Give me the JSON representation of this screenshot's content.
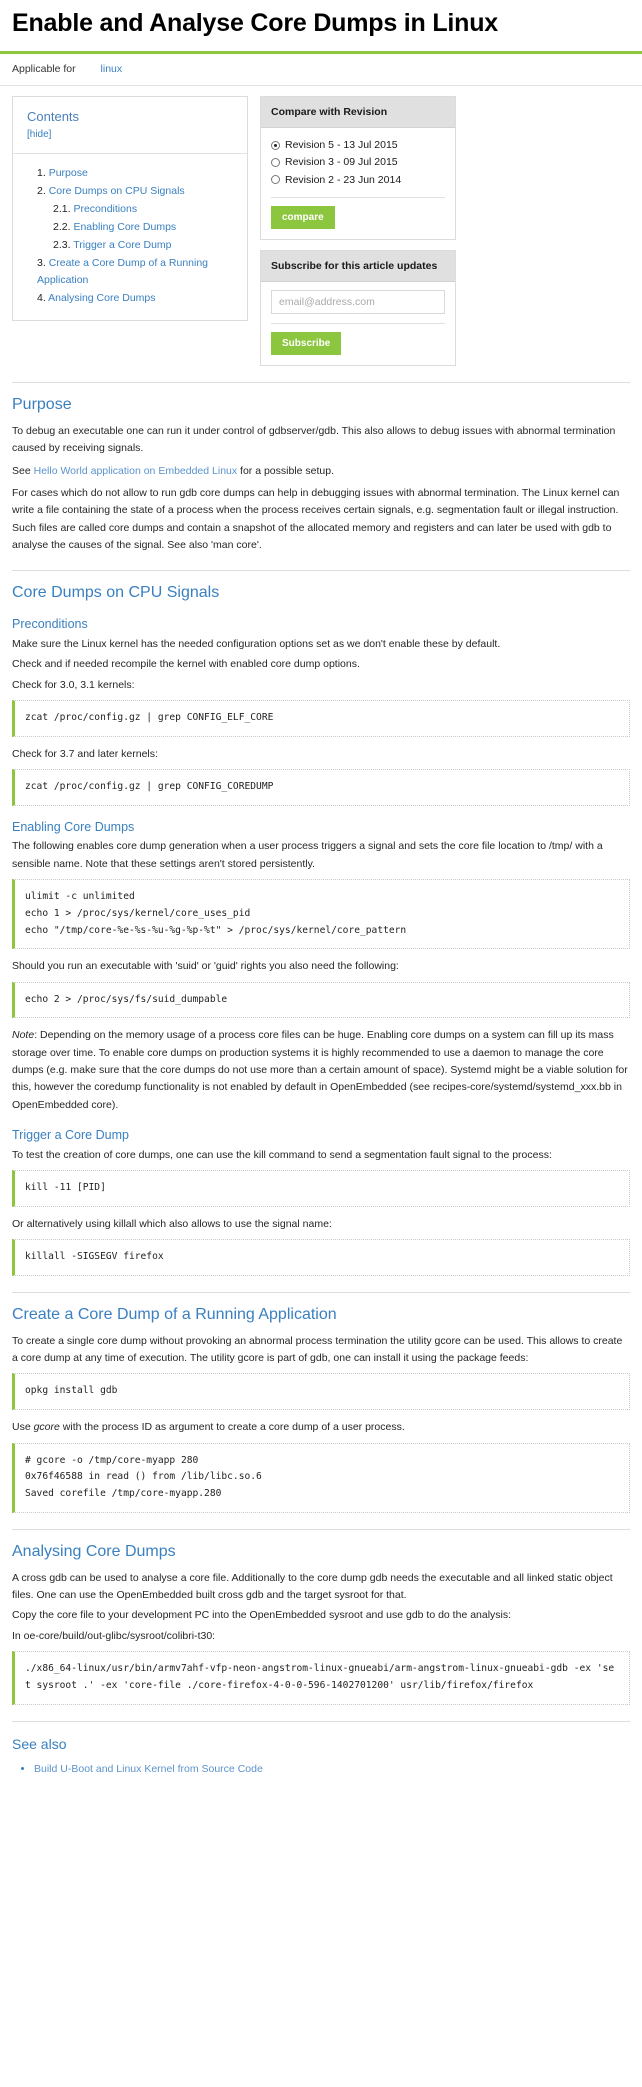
{
  "header": {
    "title": "Enable and Analyse Core Dumps in Linux",
    "applicable_label": "Applicable for",
    "applicable_tag": "linux",
    "accent_green": "#8cc63e",
    "link_blue": "#3a80c1"
  },
  "toc": {
    "title": "Contents",
    "hide_label": "[hide]",
    "items": [
      {
        "label": "Purpose",
        "children": []
      },
      {
        "label": "Core Dumps on CPU Signals",
        "children": [
          {
            "label": "Preconditions"
          },
          {
            "label": "Enabling Core Dumps"
          },
          {
            "label": "Trigger a Core Dump"
          }
        ]
      },
      {
        "label": "Create a Core Dump of a Running Application",
        "children": []
      },
      {
        "label": "Analysing Core Dumps",
        "children": []
      }
    ]
  },
  "compare_widget": {
    "title": "Compare with Revision",
    "revisions": [
      {
        "label": "Revision 5 - 13 Jul 2015",
        "checked": true
      },
      {
        "label": "Revision 3 - 09 Jul 2015",
        "checked": false
      },
      {
        "label": "Revision 2 - 23 Jun 2014",
        "checked": false
      }
    ],
    "button_label": "compare"
  },
  "subscribe_widget": {
    "title": "Subscribe for this article updates",
    "email_placeholder": "email@address.com",
    "email_value": "",
    "button_label": "Subscribe"
  },
  "sections": {
    "purpose": {
      "heading": "Purpose",
      "p1a": "To debug an executable one can run it under control of gdbserver/gdb. This also allows to debug issues with abnormal termination caused by receiving signals.",
      "p2_pre": "See ",
      "p2_link": "Hello World application on Embedded Linux",
      "p2_post": " for a possible setup.",
      "p3": "For cases which do not allow to run gdb core dumps can help in debugging issues with abnormal termination. The Linux kernel can write a file containing the state of a process when the process receives certain signals, e.g. segmentation fault or illegal instruction. Such files are called core dumps and contain a snapshot of the allocated memory and registers and can later be used with gdb to analyse the causes of the signal. See also 'man core'."
    },
    "cpu_signals": {
      "heading": "Core Dumps on CPU Signals",
      "preconditions": {
        "heading": "Preconditions",
        "p1": "Make sure the Linux kernel has the needed configuration options set as we don't enable these by default.",
        "p2": "Check and if needed recompile the kernel with enabled core dump options.",
        "p3": "Check for 3.0, 3.1 kernels:",
        "code1": "zcat /proc/config.gz | grep CONFIG_ELF_CORE",
        "p4": "Check for 3.7 and later kernels:",
        "code2": "zcat /proc/config.gz | grep CONFIG_COREDUMP"
      },
      "enabling": {
        "heading": "Enabling Core Dumps",
        "p1": "The following enables core dump generation when a user process triggers a signal and sets the core file location to /tmp/ with a sensible name. Note that these settings aren't stored persistently.",
        "code1": "ulimit -c unlimited\necho 1 > /proc/sys/kernel/core_uses_pid\necho \"/tmp/core-%e-%s-%u-%g-%p-%t\" > /proc/sys/kernel/core_pattern",
        "p2": "Should you run an executable with 'suid' or 'guid' rights you also need the following:",
        "code2": "echo 2 > /proc/sys/fs/suid_dumpable",
        "note_label": "Note",
        "note_text": ": Depending on the memory usage of a process core files can be huge. Enabling core dumps on a system can fill up its mass storage over time. To enable core dumps on production systems it is highly recommended to use a daemon to manage the core dumps (e.g. make sure that the core dumps do not use more than a certain amount of space). Systemd might be a viable solution for this, however the coredump functionality is not enabled by default in OpenEmbedded (see recipes-core/systemd/systemd_xxx.bb in OpenEmbedded core)."
      },
      "trigger": {
        "heading": "Trigger a Core Dump",
        "p1": "To test the creation of core dumps, one can use the kill command to send a segmentation fault signal to the process:",
        "code1": "kill -11 [PID]",
        "p2": "Or alternatively using killall which also allows to use the signal name:",
        "code2": "killall -SIGSEGV firefox"
      }
    },
    "create_dump": {
      "heading": "Create a Core Dump of a Running Application",
      "p1": "To create a single core dump without provoking an abnormal process termination the utility gcore can be used. This allows to create a core dump at any time of execution. The utility gcore is part of gdb, one can install it using the package feeds:",
      "code1": "opkg install gdb",
      "p2_pre": "Use ",
      "p2_ital": "gcore",
      "p2_post": " with the process ID as argument to create a core dump of a user process.",
      "code2": "# gcore -o /tmp/core-myapp 280\n0x76f46588 in read () from /lib/libc.so.6\nSaved corefile /tmp/core-myapp.280"
    },
    "analysing": {
      "heading": "Analysing Core Dumps",
      "p1": "A cross gdb can be used to analyse a core file. Additionally to the core dump gdb needs the executable and all linked static object files. One can use the OpenEmbedded built cross gdb and the target sysroot for that.",
      "p2": "Copy the core file to your development PC into the OpenEmbedded sysroot and use gdb to do the analysis:",
      "p3": "In oe-core/build/out-glibc/sysroot/colibri-t30:",
      "code1": "./x86_64-linux/usr/bin/armv7ahf-vfp-neon-angstrom-linux-gnueabi/arm-angstrom-linux-gnueabi-gdb -ex 'set sysroot .' -ex 'core-file ./core-firefox-4-0-0-596-1402701200' usr/lib/firefox/firefox"
    },
    "see_also": {
      "heading": "See also",
      "items": [
        "Build U-Boot and Linux Kernel from Source Code"
      ]
    }
  }
}
